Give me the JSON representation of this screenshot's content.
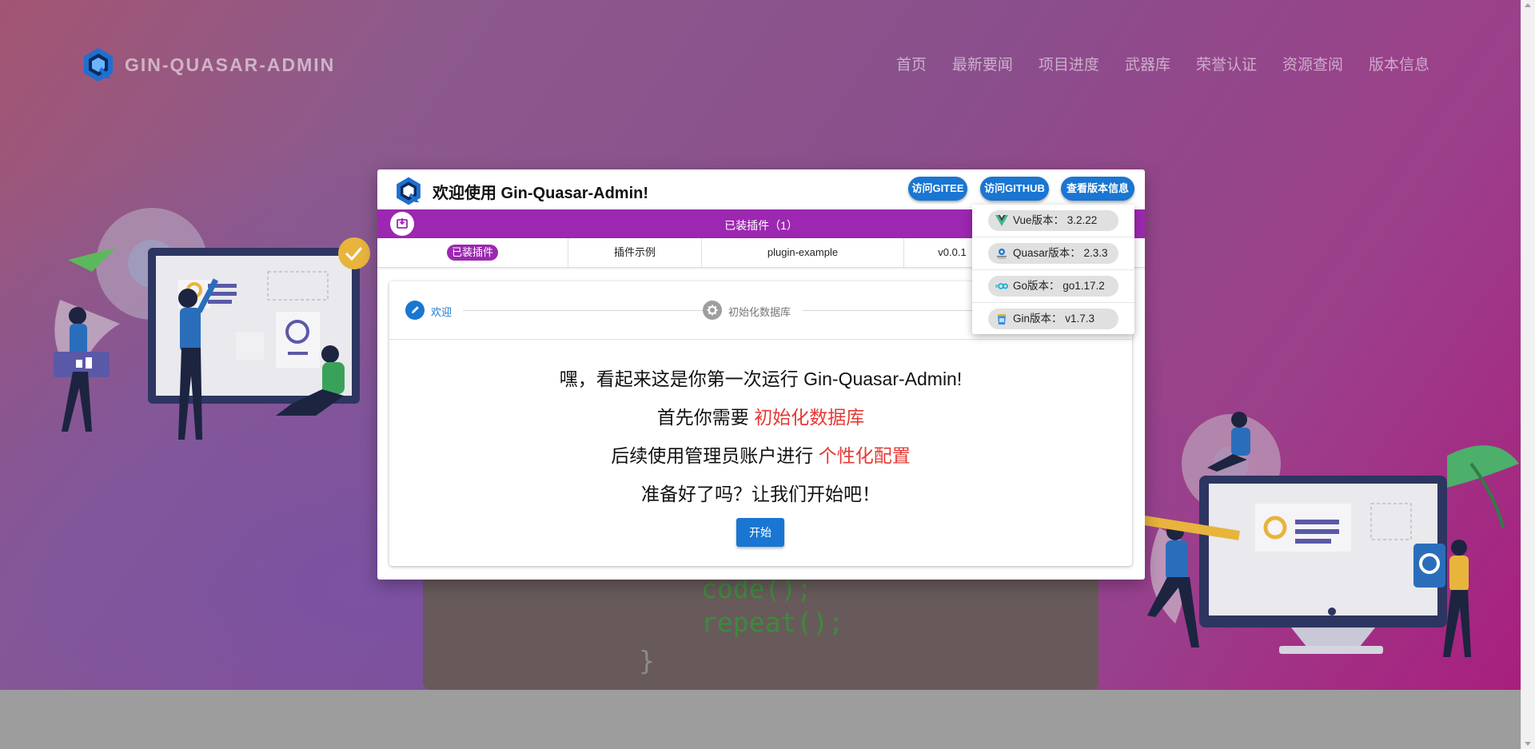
{
  "brand": {
    "name": "GIN-QUASAR-ADMIN",
    "logo_icon": "quasar-logo-icon"
  },
  "nav": {
    "items": [
      "首页",
      "最新要闻",
      "项目进度",
      "武器库",
      "荣誉认证",
      "资源查阅",
      "版本信息"
    ]
  },
  "background_code": {
    "line1": "code();",
    "line2": "repeat();",
    "line3": "}"
  },
  "dialog": {
    "title": "欢迎使用 Gin-Quasar-Admin!",
    "buttons": {
      "gitee": "访问GITEE",
      "github": "访问GITHUB",
      "version": "查看版本信息"
    },
    "plugins": {
      "bar_title": "已装插件（1）",
      "row": {
        "status": "已装插件",
        "name": "插件示例",
        "code": "plugin-example",
        "version": "v0.0.1"
      }
    },
    "stepper": {
      "step1": "欢迎",
      "step2": "初始化数据库"
    },
    "message": {
      "line1": "嘿，看起来这是你第一次运行 Gin-Quasar-Admin!",
      "line2_prefix": "首先你需要 ",
      "line2_highlight": "初始化数据库",
      "line3_prefix": "后续使用管理员账户进行 ",
      "line3_highlight": "个性化配置",
      "line4": "准备好了吗？让我们开始吧！"
    },
    "start_button": "开始"
  },
  "version_menu": {
    "items": [
      {
        "icon": "vue-icon",
        "label": "Vue版本：  3.2.22"
      },
      {
        "icon": "quasar-icon",
        "label": "Quasar版本：  2.3.3"
      },
      {
        "icon": "go-icon",
        "label": "Go版本：  go1.17.2"
      },
      {
        "icon": "gin-icon",
        "label": "Gin版本：  v1.7.3"
      }
    ]
  },
  "colors": {
    "primary": "#1976d2",
    "purple": "#9c27b0",
    "highlight_red": "#e53935"
  }
}
